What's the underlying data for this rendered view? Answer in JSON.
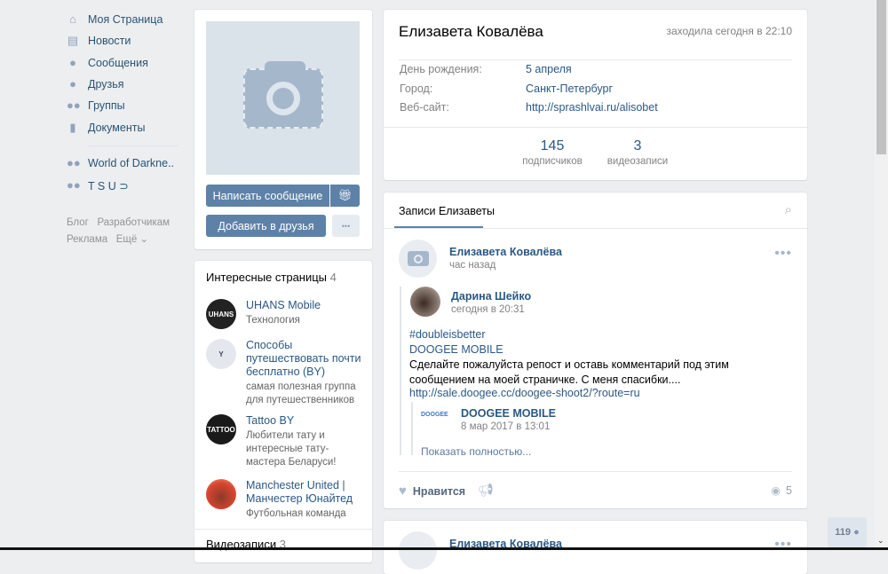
{
  "nav": {
    "items": [
      {
        "label": "Моя Страница",
        "icon": "home-icon"
      },
      {
        "label": "Новости",
        "icon": "news-icon"
      },
      {
        "label": "Сообщения",
        "icon": "messages-icon"
      },
      {
        "label": "Друзья",
        "icon": "friends-icon"
      },
      {
        "label": "Группы",
        "icon": "groups-icon"
      },
      {
        "label": "Документы",
        "icon": "documents-icon"
      }
    ],
    "groups": [
      {
        "label": "World of Darkne.."
      },
      {
        "label": "T S U ⊃"
      }
    ],
    "footer": [
      "Блог",
      "Разработчикам",
      "Реклама",
      "Ещё ⌄"
    ]
  },
  "profile": {
    "send_message": "Написать сообщение",
    "add_friend": "Добавить в друзья",
    "more": "•••",
    "name": "Елизавета Ковалёва",
    "last_seen": "заходила сегодня в 22:10",
    "info": [
      {
        "label": "День рождения:",
        "value": "5 апреля"
      },
      {
        "label": "Город:",
        "value": "Санкт-Петербург"
      },
      {
        "label": "Веб-сайт:",
        "value": "http://sprashlvai.ru/alisobet"
      }
    ],
    "counters": [
      {
        "value": "145",
        "label": "подписчиков"
      },
      {
        "value": "3",
        "label": "видеозаписи"
      }
    ]
  },
  "pages": {
    "title": "Интересные страницы",
    "count": "4",
    "items": [
      {
        "name": "UHANS Mobile",
        "desc": "Технология",
        "avatar_text": "UHANS",
        "color": "#222222"
      },
      {
        "name": "Способы путешествовать почти бесплатно (BY)",
        "desc": "самая полезная группа для путешественников",
        "avatar_text": "",
        "color": "#e4e8ee"
      },
      {
        "name": "Tattoo BY",
        "desc": "Любители тату и интересные тату-мастера Беларуси!",
        "avatar_text": "TATTOO",
        "color": "#1a1a1a"
      },
      {
        "name": "Manchester United | Манчестер Юнайтед",
        "desc": "Футбольная команда",
        "avatar_text": "",
        "color": "#c0392b"
      }
    ]
  },
  "videos": {
    "title": "Видеозаписи",
    "count": "3"
  },
  "wall": {
    "tab": "Записи Елизаветы",
    "post": {
      "author": "Елизавета Ковалёва",
      "time": "час назад",
      "repost": {
        "author": "Дарина Шейко",
        "time": "сегодня в 20:31",
        "lines": [
          "#doubleisbetter",
          "DOOGEE MOBILE"
        ],
        "text": "Сделайте пожалуйста репост и оставь комментарий под этим сообщением на моей страничке. С меня спасибки....",
        "link": "http://sale.doogee.cc/doogee-shoot2/?route=ru",
        "inner": {
          "author": "DOOGEE MOBILE",
          "time": "8 мар 2017 в 13:01",
          "logo": "DOOGEE",
          "show_more": "Показать полностью..."
        }
      },
      "like": "Нравится",
      "views": "5"
    },
    "post2": {
      "author": "Елизавета Ковалёва"
    }
  },
  "online_counter": "119"
}
